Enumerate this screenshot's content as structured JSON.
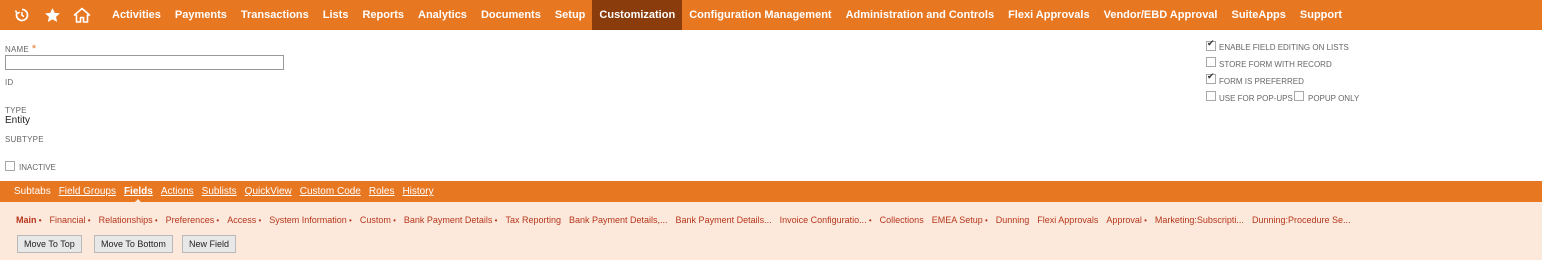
{
  "top_nav": {
    "items": [
      "Activities",
      "Payments",
      "Transactions",
      "Lists",
      "Reports",
      "Analytics",
      "Documents",
      "Setup",
      "Customization",
      "Configuration Management",
      "Administration and Controls",
      "Flexi Approvals",
      "Vendor/EBD Approval",
      "SuiteApps",
      "Support"
    ],
    "active": "Customization",
    "icons": [
      "recent-history-icon",
      "star-icon",
      "home-icon"
    ]
  },
  "form": {
    "name_label": "NAME",
    "required_mark": "*",
    "name_value": "",
    "id_label": "ID",
    "type_label": "TYPE",
    "type_value": "Entity",
    "subtype_label": "SUBTYPE",
    "inactive_label": "INACTIVE"
  },
  "options": {
    "enable_field_editing": {
      "label": "ENABLE FIELD EDITING ON LISTS",
      "checked": true
    },
    "store_form": {
      "label": "STORE FORM WITH RECORD",
      "checked": false
    },
    "form_preferred": {
      "label": "FORM IS PREFERRED",
      "checked": true
    },
    "use_popups": {
      "label": "USE FOR POP-UPS",
      "checked": false
    },
    "popup_only": {
      "label": "POPUP ONLY",
      "checked": false
    }
  },
  "subtabs": {
    "items": [
      "Subtabs",
      "Field Groups",
      "Fields",
      "Actions",
      "Sublists",
      "QuickView",
      "Custom Code",
      "Roles",
      "History"
    ],
    "active": "Fields"
  },
  "field_tabs": [
    {
      "label": "Main",
      "dropdown": true
    },
    {
      "label": "Financial",
      "dropdown": true
    },
    {
      "label": "Relationships",
      "dropdown": true
    },
    {
      "label": "Preferences",
      "dropdown": true
    },
    {
      "label": "Access",
      "dropdown": true
    },
    {
      "label": "System Information",
      "dropdown": true
    },
    {
      "label": "Custom",
      "dropdown": true
    },
    {
      "label": "Bank Payment Details",
      "dropdown": true
    },
    {
      "label": "Tax Reporting",
      "dropdown": false
    },
    {
      "label": "Bank Payment Details,...",
      "dropdown": false
    },
    {
      "label": "Bank Payment Details...",
      "dropdown": false
    },
    {
      "label": "Invoice Configuratio...",
      "dropdown": true
    },
    {
      "label": "Collections",
      "dropdown": false
    },
    {
      "label": "EMEA Setup",
      "dropdown": true
    },
    {
      "label": "Dunning",
      "dropdown": false
    },
    {
      "label": "Flexi Approvals",
      "dropdown": false
    },
    {
      "label": "Approval",
      "dropdown": true
    },
    {
      "label": "Marketing:Subscripti...",
      "dropdown": false
    },
    {
      "label": "Dunning:Procedure Se...",
      "dropdown": false
    }
  ],
  "buttons": {
    "move_top": "Move To Top",
    "move_bottom": "Move To Bottom",
    "new_field": "New Field"
  },
  "colors": {
    "brand_orange": "#e87722",
    "active_nav": "#8b3c0c",
    "panel_bg": "#fde9dc",
    "tab_text": "#b5361b"
  }
}
